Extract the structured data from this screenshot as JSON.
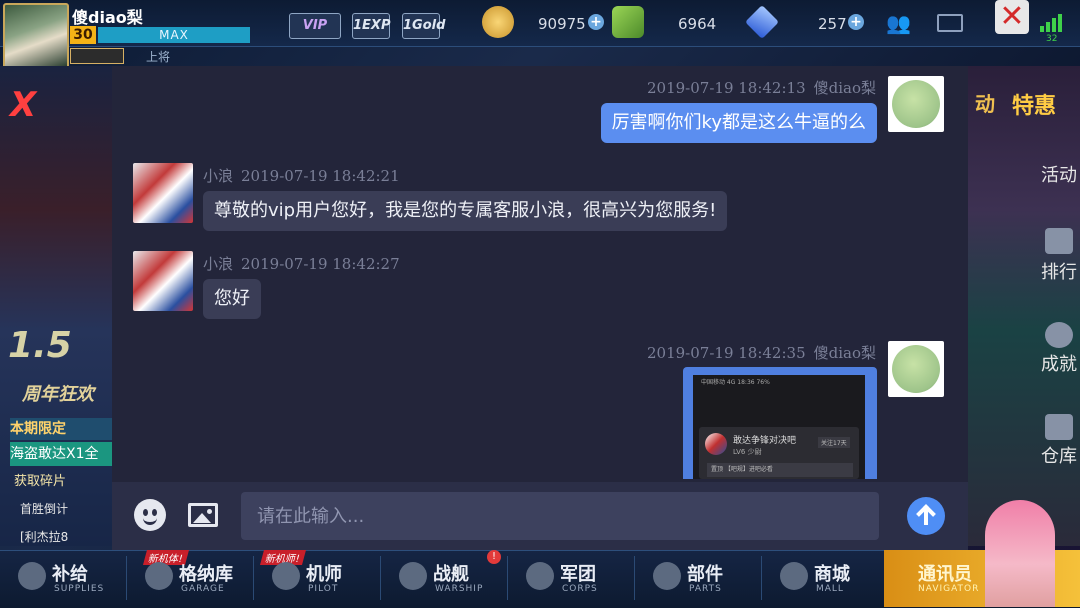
{
  "topbar": {
    "player_name": "傻diao梨",
    "level": "30",
    "exp_label": "MAX",
    "rank_label": "上将",
    "badges": [
      "VIP",
      "1EXP",
      "1Gold"
    ],
    "gold": "90975",
    "gems": "6964",
    "crystals": "257",
    "signal_level": "32"
  },
  "left_panel": {
    "anniversary": "1.5",
    "anniversary_sub": "周年狂欢",
    "limited": "本期限定",
    "pirate": "海盗敢达X1全",
    "shard": "获取碎片",
    "row1": "首胜倒计",
    "row2": "[利杰拉8"
  },
  "right_panel": {
    "promo_left": "动",
    "promo_right": "特惠",
    "item1": "活动",
    "item2": "排行",
    "item3": "成就",
    "item4": "仓库"
  },
  "chat": {
    "messages": [
      {
        "sender": "傻diao梨",
        "time": "2019-07-19 18:42:13",
        "text": "厉害啊你们ky都是这么牛逼的么"
      },
      {
        "sender": "小浪",
        "time": "2019-07-19 18:42:21",
        "text": "尊敬的vip用户您好，我是您的专属客服小浪，很高兴为您服务!"
      },
      {
        "sender": "小浪",
        "time": "2019-07-19 18:42:27",
        "text": "您好"
      },
      {
        "sender": "傻diao梨",
        "time": "2019-07-19 18:42:35",
        "text": ""
      }
    ],
    "screenshot": {
      "status": "中国移动 4G      18:36      76%",
      "title": "敢达争锋对决吧",
      "subtitle": "LV6 少尉",
      "tag": "关注17天",
      "note": "置顶  【吧规】进吧必看"
    },
    "input_placeholder": "请在此输入..."
  },
  "bottomnav": {
    "items": [
      {
        "label": "补给",
        "sub": "SUPPLIES",
        "badge": ""
      },
      {
        "label": "格纳库",
        "sub": "GARAGE",
        "badge": "新机体!"
      },
      {
        "label": "机师",
        "sub": "PILOT",
        "badge": "新机师!"
      },
      {
        "label": "战舰",
        "sub": "WARSHIP",
        "badge": ""
      },
      {
        "label": "军团",
        "sub": "CORPS",
        "badge": ""
      },
      {
        "label": "部件",
        "sub": "PARTS",
        "badge": ""
      },
      {
        "label": "商城",
        "sub": "MALL",
        "badge": ""
      }
    ],
    "navigator": {
      "label": "通讯员",
      "sub": "NAVIGATOR"
    }
  }
}
